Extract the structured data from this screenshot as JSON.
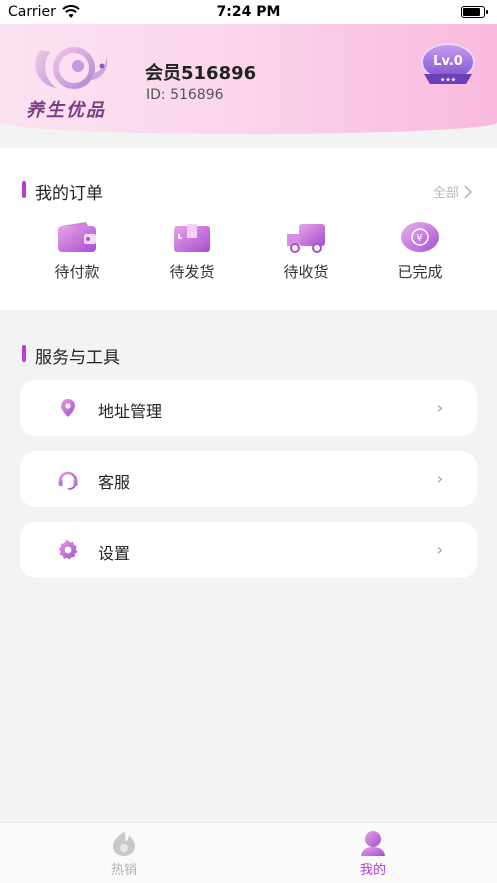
{
  "status_bar": {
    "carrier": "Carrier",
    "time": "7:24 PM"
  },
  "profile": {
    "logo_text": "养生优品",
    "name": "会员516896",
    "id_text": "ID: 516896",
    "level": "Lv.0"
  },
  "orders": {
    "title": "我的订单",
    "all_label": "全部",
    "items": [
      {
        "label": "待付款",
        "icon": "wallet-icon"
      },
      {
        "label": "待发货",
        "icon": "box-icon"
      },
      {
        "label": "待收货",
        "icon": "truck-icon"
      },
      {
        "label": "已完成",
        "icon": "coin-icon"
      }
    ]
  },
  "services": {
    "title": "服务与工具",
    "items": [
      {
        "label": "地址管理",
        "icon": "location-pin-icon"
      },
      {
        "label": "客服",
        "icon": "headset-icon"
      },
      {
        "label": "设置",
        "icon": "gear-icon"
      }
    ]
  },
  "tabs": [
    {
      "label": "热销",
      "icon": "hot-icon",
      "active": false
    },
    {
      "label": "我的",
      "icon": "profile-icon",
      "active": true
    }
  ],
  "colors": {
    "accent": "#b23fd6",
    "header_gradient_start": "#fbe3f1",
    "header_gradient_end": "#f9b9de",
    "tab_inactive": "#b4b4b4"
  }
}
